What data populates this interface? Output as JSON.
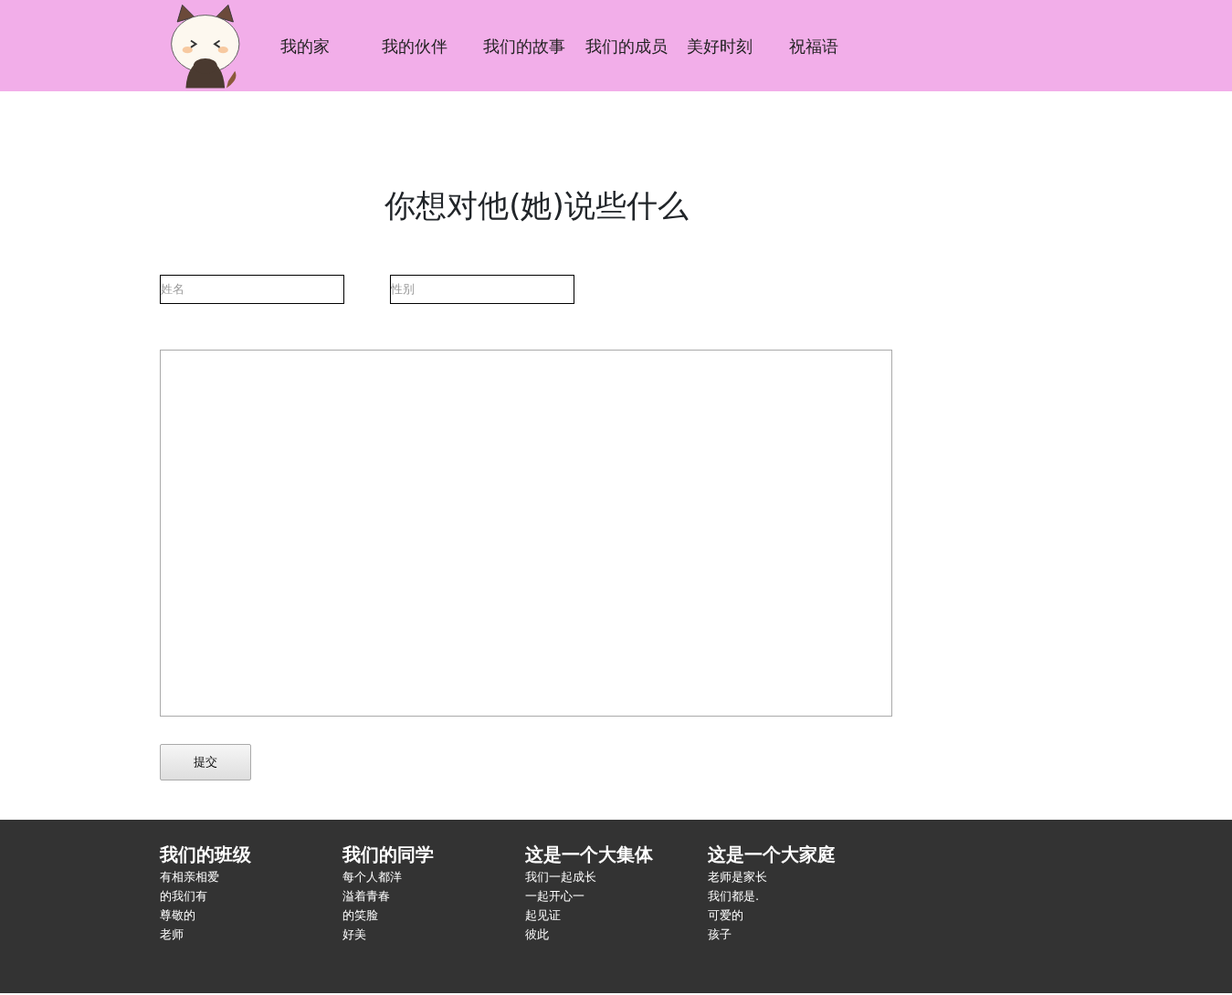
{
  "nav": {
    "items": [
      "我的家",
      "我的伙伴",
      "我们的故事",
      "我们的成员",
      "美好时刻",
      "祝福语"
    ]
  },
  "form": {
    "title": "你想对他(她)说些什么",
    "name_field": {
      "placeholder": "姓名"
    },
    "gender_field": {
      "placeholder": "性别"
    },
    "submit": "提交"
  },
  "footer": {
    "columns": [
      {
        "heading": "我们的班级",
        "lines": [
          "有相亲相爱",
          "的我们有",
          "尊敬的",
          "老师"
        ]
      },
      {
        "heading": "我们的同学",
        "lines": [
          "每个人都洋",
          "溢着青春",
          "的笑脸",
          "好美"
        ]
      },
      {
        "heading": "这是一个大集体",
        "lines": [
          "我们一起成长",
          "一起开心一",
          "起见证",
          "彼此"
        ]
      },
      {
        "heading": "这是一个大家庭",
        "lines": [
          "老师是家长",
          "我们都是.",
          "可爱的",
          "孩子"
        ]
      }
    ]
  }
}
